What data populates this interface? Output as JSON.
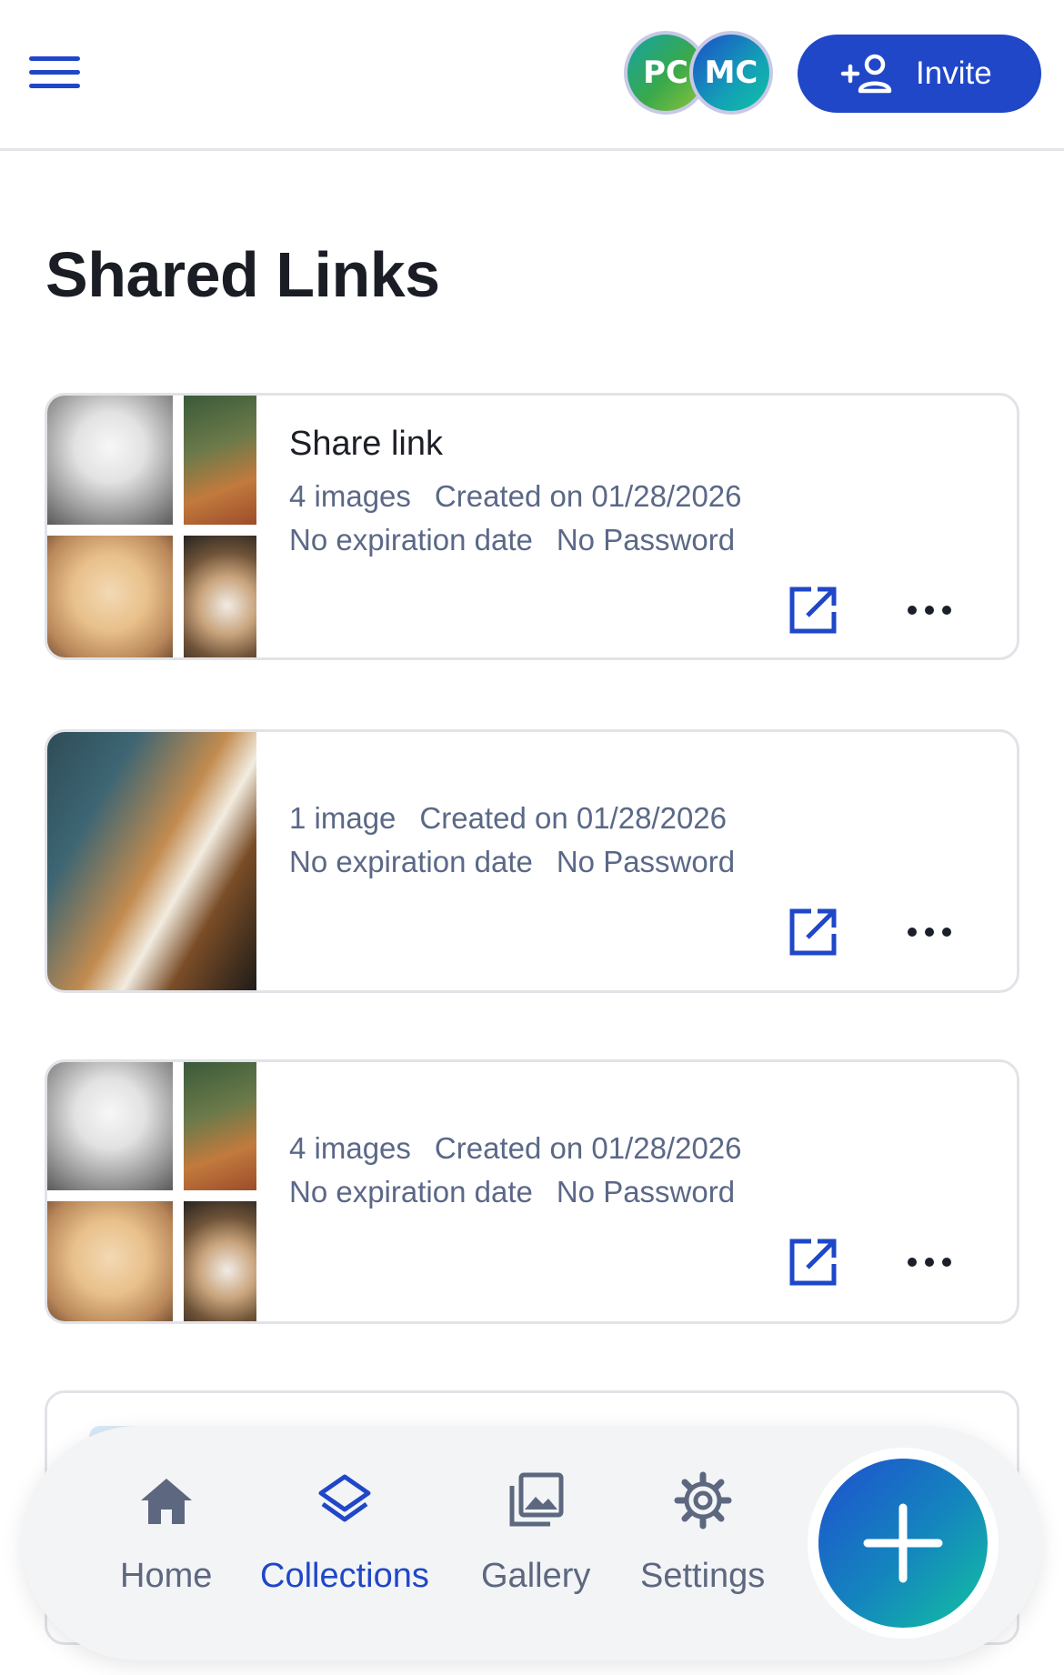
{
  "header": {
    "avatars": [
      {
        "initials": "PC",
        "name": "avatar-pc"
      },
      {
        "initials": "MC",
        "name": "avatar-mc"
      }
    ],
    "invite_label": "Invite"
  },
  "page_title": "Shared Links",
  "links": [
    {
      "title": "Share link",
      "count": "4 images",
      "created": "Created on 01/28/2026",
      "expiration": "No expiration date",
      "password": "No Password"
    },
    {
      "title": "",
      "count": "1 image",
      "created": "Created on 01/28/2026",
      "expiration": "No expiration date",
      "password": "No Password"
    },
    {
      "title": "",
      "count": "4 images",
      "created": "Created on 01/28/2026",
      "expiration": "No expiration date",
      "password": "No Password"
    }
  ],
  "bottom_nav": {
    "items": [
      {
        "label": "Home",
        "icon": "home-icon"
      },
      {
        "label": "Collections",
        "icon": "layers-icon",
        "active": true
      },
      {
        "label": "Gallery",
        "icon": "gallery-icon"
      },
      {
        "label": "Settings",
        "icon": "gear-icon"
      }
    ],
    "fab_icon": "plus-icon"
  },
  "colors": {
    "primary": "#1f47c8",
    "meta_text": "#5b6887",
    "nav_inactive": "#5d6880",
    "border": "#e1e3e8"
  }
}
